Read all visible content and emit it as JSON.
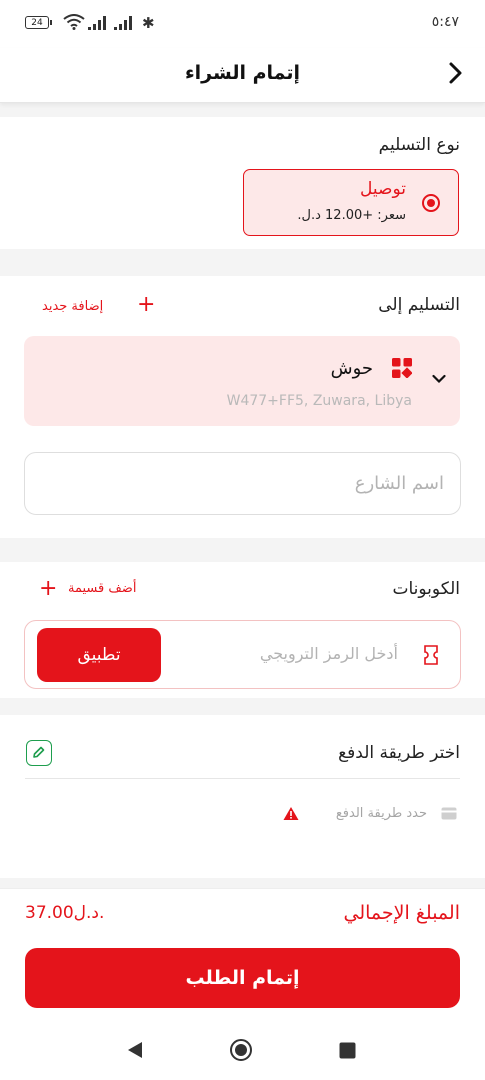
{
  "status_bar": {
    "battery": "24",
    "time": "٥:٤٧"
  },
  "header": {
    "title": "إتمام الشراء"
  },
  "delivery_type": {
    "title": "نوع التسليم",
    "option_name": "توصيل",
    "option_price": "سعر: +12.00 د.ل."
  },
  "deliver_to": {
    "title": "التسليم إلى",
    "add_new_label": "إضافة جديد",
    "address_name": "حوش",
    "address_code": "W477+FF5, Zuwara, Libya",
    "street_placeholder": "اسم الشارع"
  },
  "coupons": {
    "title": "الكوبونات",
    "add_voucher_label": "أضف قسيمة",
    "promo_placeholder": "أدخل الرمز الترويجي",
    "apply_label": "تطبيق"
  },
  "payment": {
    "title": "اختر طريقة الدفع",
    "select_hint": "حدد طريقة الدفع"
  },
  "summary": {
    "total_label": "المبلغ الإجمالي",
    "total_value": "37.00د.ل.",
    "checkout_label": "إتمام الطلب"
  },
  "colors": {
    "accent": "#e4141b",
    "accent_light": "#fde8e8",
    "edit_green": "#1e9e4e"
  }
}
